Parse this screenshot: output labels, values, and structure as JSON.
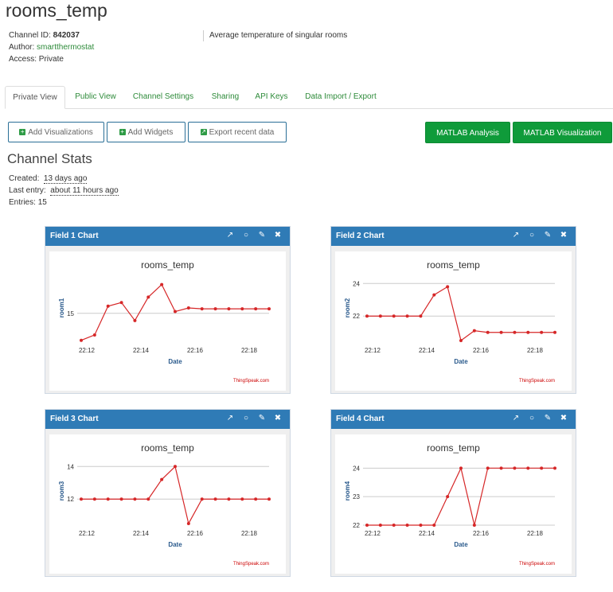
{
  "channel": {
    "title": "rooms_temp",
    "id_label": "Channel ID:",
    "id_value": "842037",
    "author_label": "Author:",
    "author_value": "smartthermostat",
    "access_label": "Access:",
    "access_value": "Private",
    "description": "Average temperature of singular rooms"
  },
  "tabs": [
    "Private View",
    "Public View",
    "Channel Settings",
    "Sharing",
    "API Keys",
    "Data Import / Export"
  ],
  "buttons": {
    "add_visualizations": "Add Visualizations",
    "add_widgets": "Add Widgets",
    "export_recent": "Export recent data",
    "matlab_analysis": "MATLAB Analysis",
    "matlab_visualization": "MATLAB Visualization"
  },
  "stats": {
    "title": "Channel Stats",
    "created_label": "Created:",
    "created_value": "13 days ago",
    "last_entry_label": "Last entry:",
    "last_entry_value": "about 11 hours ago",
    "entries_label": "Entries:",
    "entries_value": "15"
  },
  "colors": {
    "panel_header": "#2f7bb6",
    "line": "#d62728",
    "accent_green": "#0f9b3a"
  },
  "chart_data": [
    {
      "type": "line",
      "panel_title": "Field 1 Chart",
      "title": "rooms_temp",
      "xlabel": "Date",
      "ylabel": "room1",
      "credit": "ThingSpeak.com",
      "x_ticks": [
        "22:12",
        "22:14",
        "22:16",
        "22:18"
      ],
      "y_ticks": [
        15
      ],
      "ylim": [
        13.4,
        17.2
      ],
      "values": [
        13.5,
        13.8,
        15.4,
        15.6,
        14.6,
        15.9,
        16.6,
        15.1,
        15.3,
        15.25,
        15.25,
        15.25,
        15.25,
        15.25,
        15.25
      ]
    },
    {
      "type": "line",
      "panel_title": "Field 2 Chart",
      "title": "rooms_temp",
      "xlabel": "Date",
      "ylabel": "room2",
      "credit": "ThingSpeak.com",
      "x_ticks": [
        "22:12",
        "22:14",
        "22:16",
        "22:18"
      ],
      "y_ticks": [
        22,
        24
      ],
      "ylim": [
        20.4,
        24.6
      ],
      "values": [
        22,
        22,
        22,
        22,
        22,
        23.3,
        23.8,
        20.5,
        21.1,
        21,
        21,
        21,
        21,
        21,
        21
      ]
    },
    {
      "type": "line",
      "panel_title": "Field 3 Chart",
      "title": "rooms_temp",
      "xlabel": "Date",
      "ylabel": "room3",
      "credit": "ThingSpeak.com",
      "x_ticks": [
        "22:12",
        "22:14",
        "22:16",
        "22:18"
      ],
      "y_ticks": [
        12,
        14
      ],
      "ylim": [
        10.4,
        14.6
      ],
      "values": [
        12,
        12,
        12,
        12,
        12,
        12,
        13.2,
        14,
        10.5,
        12,
        12,
        12,
        12,
        12,
        12
      ]
    },
    {
      "type": "line",
      "panel_title": "Field 4 Chart",
      "title": "rooms_temp",
      "xlabel": "Date",
      "ylabel": "room4",
      "credit": "ThingSpeak.com",
      "x_ticks": [
        "22:12",
        "22:14",
        "22:16",
        "22:18"
      ],
      "y_ticks": [
        22,
        23,
        24
      ],
      "ylim": [
        22,
        24.4
      ],
      "values": [
        22,
        22,
        22,
        22,
        22,
        22,
        23,
        24,
        22,
        24,
        24,
        24,
        24,
        24,
        24
      ]
    }
  ]
}
